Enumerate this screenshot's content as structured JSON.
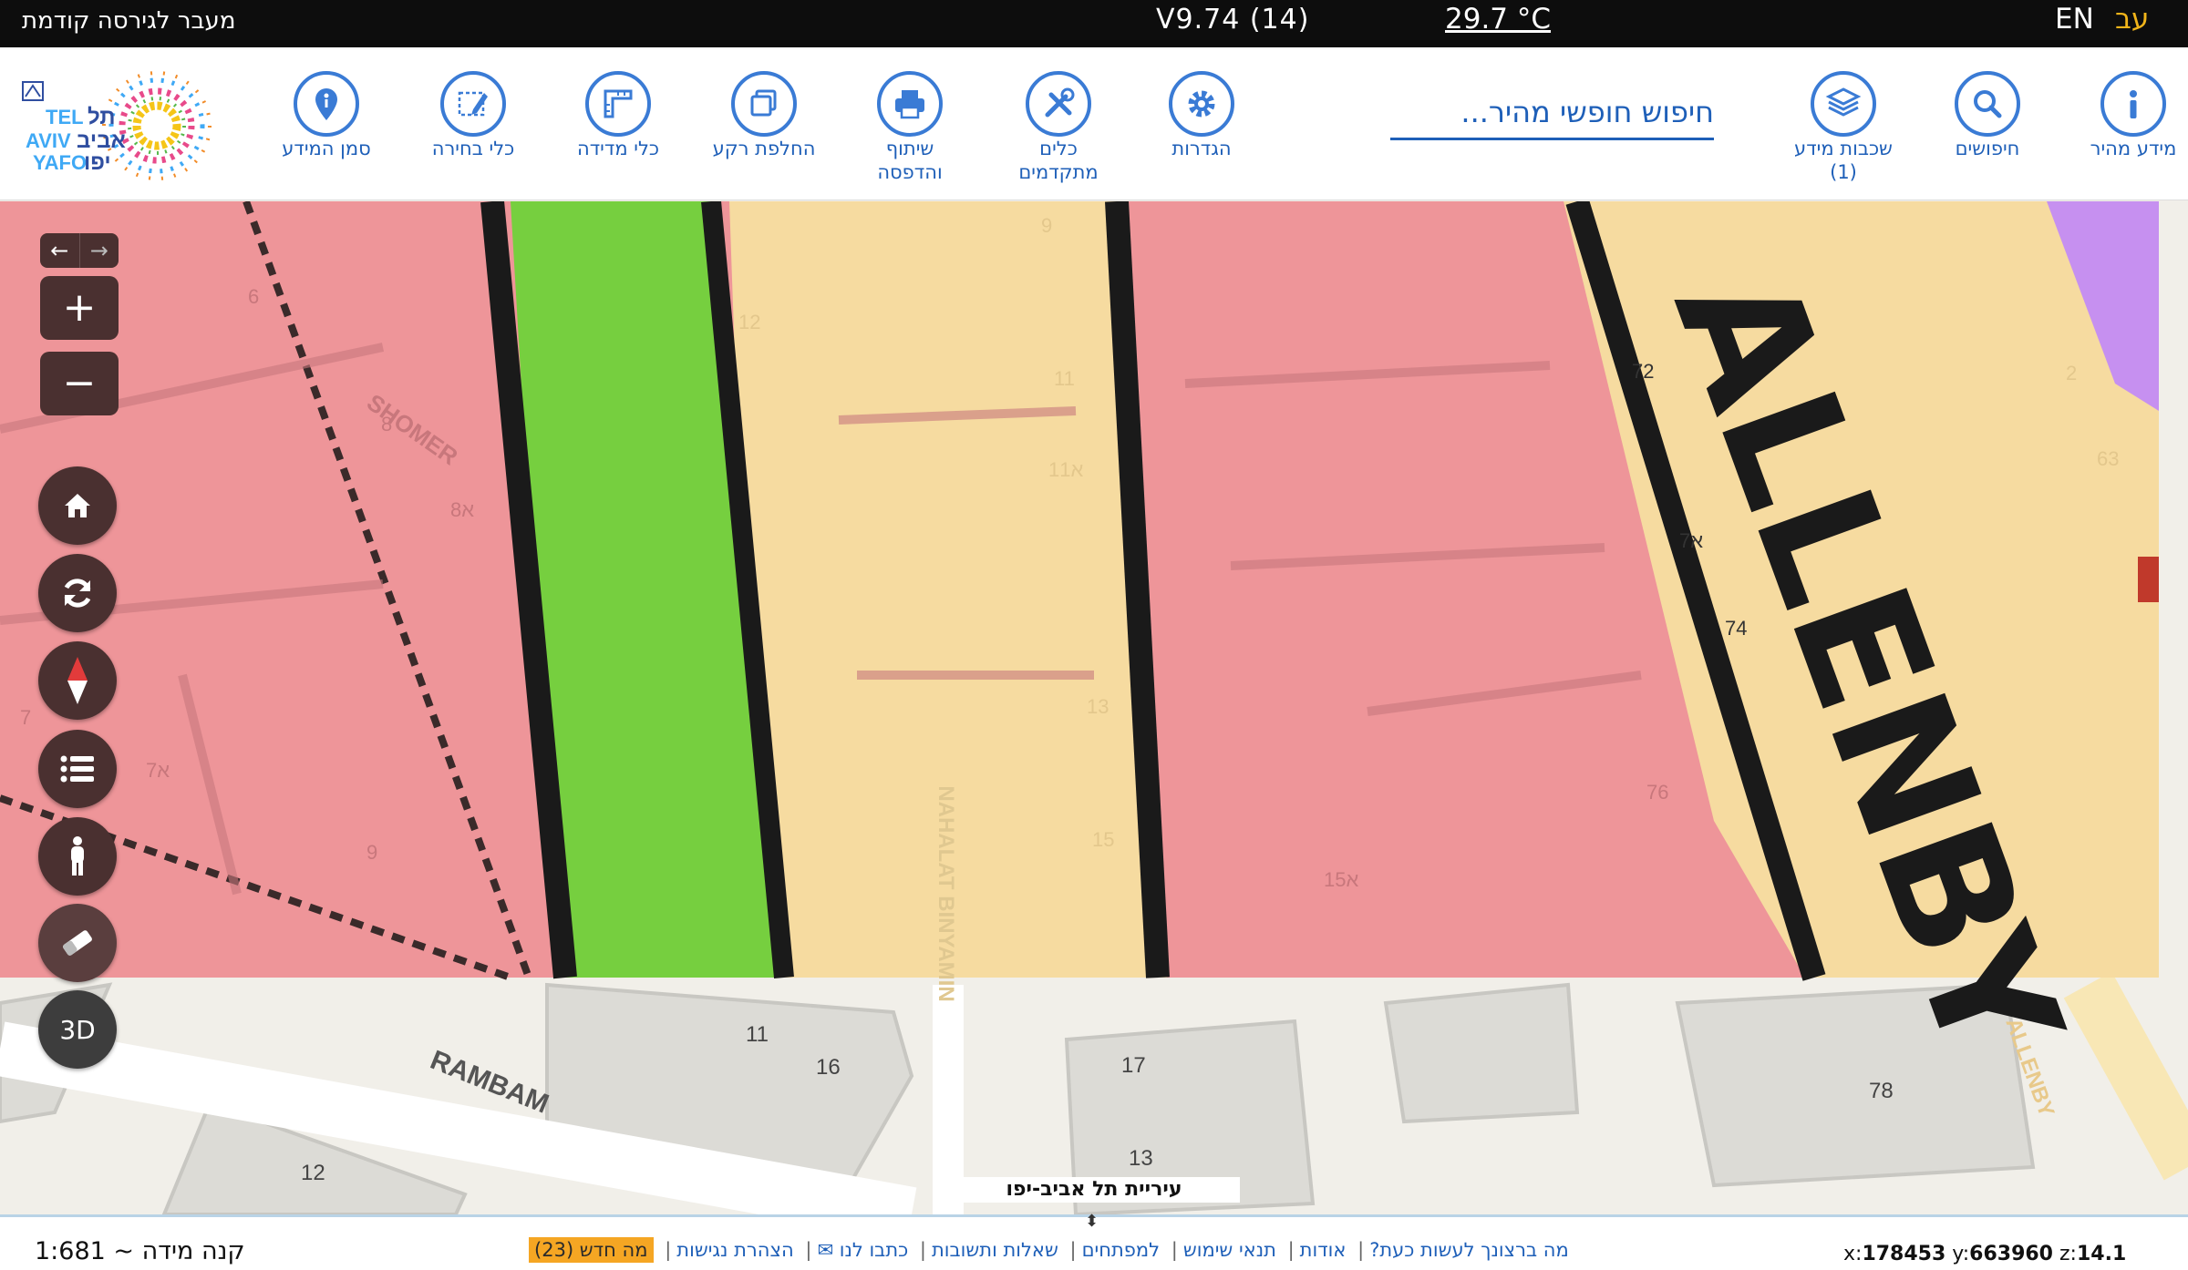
{
  "topbar": {
    "prev_version": "מעבר לגירסה קודמת",
    "version": "V9.74 (14)",
    "temperature": "29.7 °C",
    "lang_en": "EN",
    "lang_he": "עב"
  },
  "logo": {
    "latin_lines": [
      "TEL",
      "AVIV",
      "YAFO"
    ],
    "hebrew_lines": [
      "תל",
      "אביב",
      "יפו"
    ]
  },
  "toolbar": {
    "tools": [
      {
        "id": "quick-info",
        "label": "מידע מהיר",
        "icon": "info-icon"
      },
      {
        "id": "searches",
        "label": "חיפושים",
        "icon": "search-icon"
      },
      {
        "id": "layers",
        "label": "שכבות מידע",
        "label2": "(1)",
        "icon": "layers-icon"
      },
      {
        "id": "settings",
        "label": "הגדרות",
        "icon": "gear-icon"
      },
      {
        "id": "advanced-tools",
        "label": "כלים",
        "label2": "מתקדמים",
        "icon": "tools-icon"
      },
      {
        "id": "share-print",
        "label": "שיתוף",
        "label2": "והדפסה",
        "icon": "printer-icon"
      },
      {
        "id": "basemap",
        "label": "החלפת רקע",
        "icon": "basemap-icon"
      },
      {
        "id": "measure",
        "label": "כלי מדידה",
        "icon": "ruler-icon"
      },
      {
        "id": "select",
        "label": "כלי בחירה",
        "icon": "select-icon"
      },
      {
        "id": "marker",
        "label": "סמן המידע",
        "icon": "pin-icon"
      }
    ],
    "search_placeholder": "חיפוש חופשי מהיר..."
  },
  "map": {
    "street_labels": [
      "SHOMER",
      "NAHALAT BINYAMIN",
      "RAMBAM",
      "ALLENBY"
    ],
    "parcel_numbers": [
      "6",
      "8",
      "8א",
      "7",
      "7א",
      "9",
      "12",
      "9",
      "11",
      "11א",
      "13",
      "15",
      "72",
      "74",
      "7א",
      "2",
      "63",
      "76",
      "15א",
      "11",
      "16",
      "17",
      "13",
      "78",
      "12"
    ],
    "big_text": "ALLENBY",
    "credit": "עיריית תל אביב-יפו",
    "colors": {
      "residential": "#ee9599",
      "commercial": "#f6dba0",
      "green": "#76cf3f",
      "public": "#c690f0",
      "base": "#f1efe9"
    }
  },
  "controls": {
    "zoom_in": "+",
    "zoom_out": "−",
    "three_d": "3D"
  },
  "bottombar": {
    "scale": "קנה מידה ~ 1:681",
    "links": [
      "מה ברצונך לעשות כעת?",
      "אודות",
      "תנאי שימוש",
      "למפתחים",
      "שאלות ותשובות",
      "כתבו לנו ✉",
      "הצהרת נגישות"
    ],
    "news": "מה חדש (23)",
    "coords": {
      "x_label": "x:",
      "x": "178453",
      "y_label": "y:",
      "y": "663960",
      "z_label": "z:",
      "z": "14.1"
    }
  }
}
